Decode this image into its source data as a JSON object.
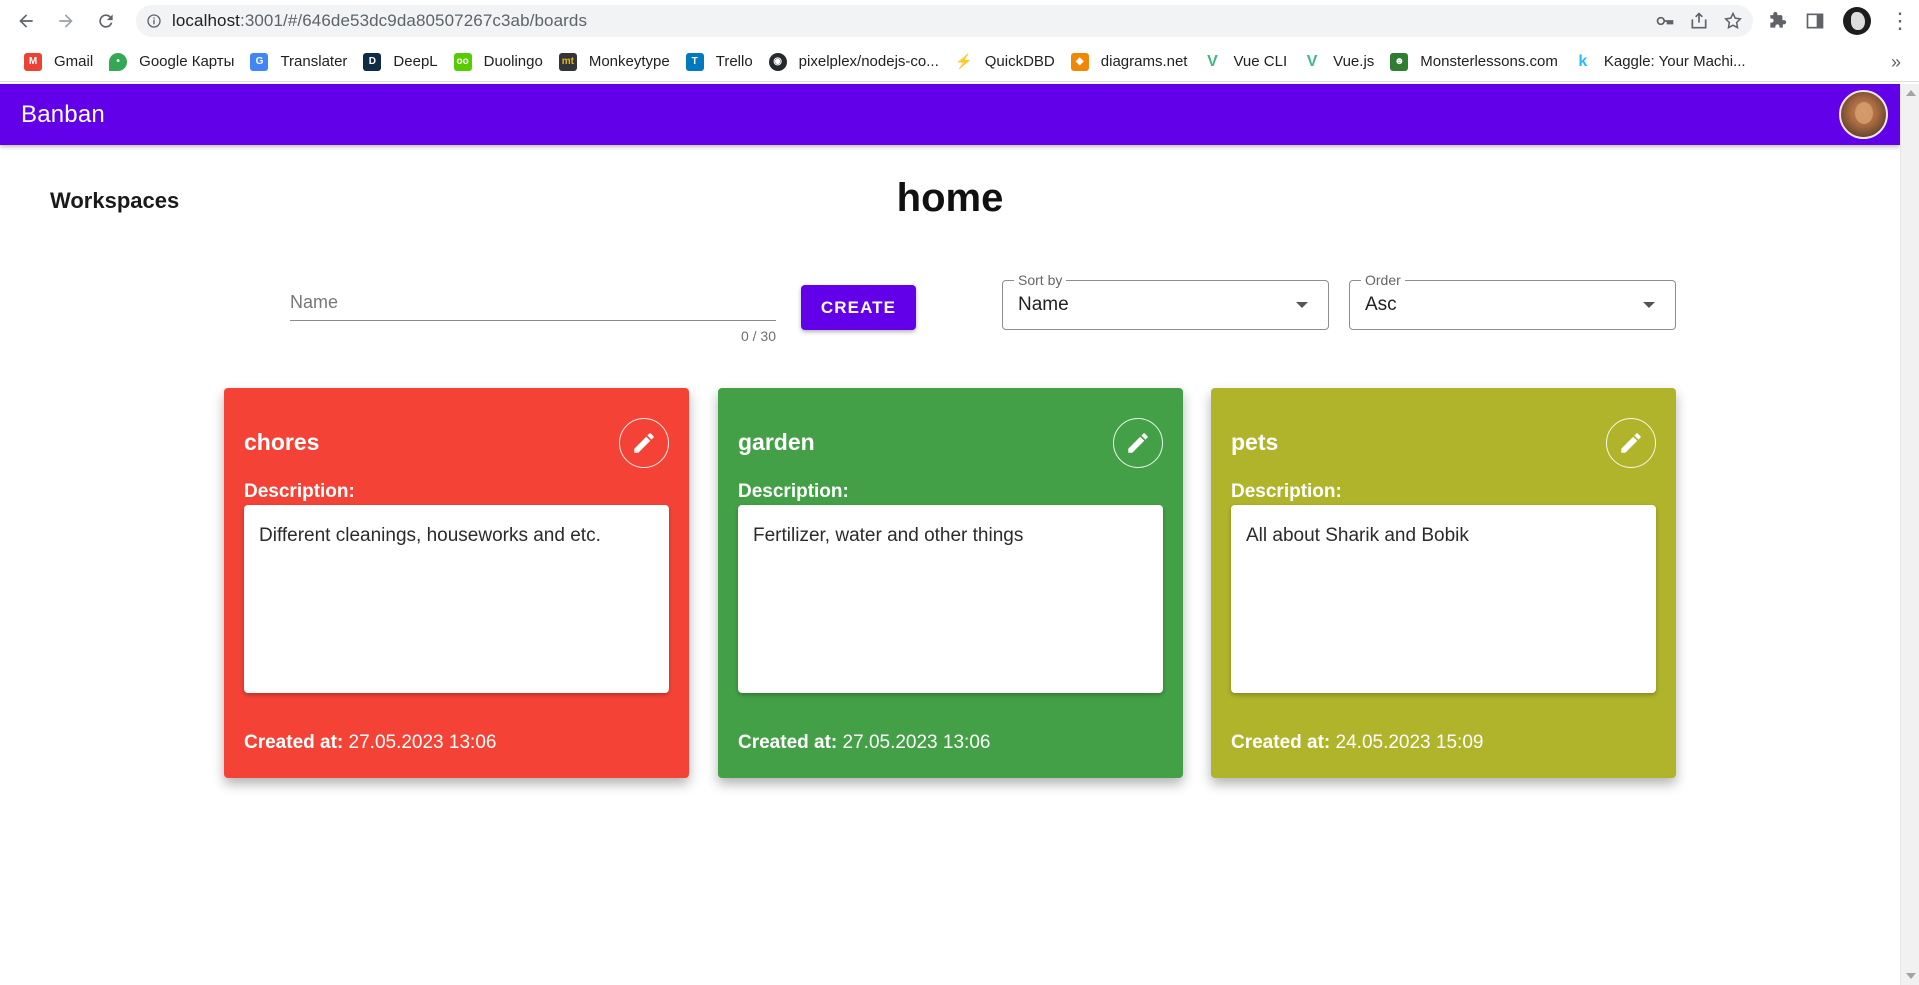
{
  "browser": {
    "url_host": "localhost",
    "url_rest": ":3001/#/646de53dc9da80507267c3ab/boards",
    "bookmarks": [
      {
        "label": "Gmail",
        "color": "#ea4335",
        "glyph": "M"
      },
      {
        "label": "Google Карты",
        "color": "#34a853",
        "glyph": "•"
      },
      {
        "label": "Translater",
        "color": "#4285f4",
        "glyph": "G"
      },
      {
        "label": "DeepL",
        "color": "#0f2b46",
        "glyph": "D"
      },
      {
        "label": "Duolingo",
        "color": "#58cc02",
        "glyph": "oo"
      },
      {
        "label": "Monkeytype",
        "color": "#323437",
        "glyph": "mt"
      },
      {
        "label": "Trello",
        "color": "#0079bf",
        "glyph": "T"
      },
      {
        "label": "pixelplex/nodejs-co...",
        "color": "#24292e",
        "glyph": "◉"
      },
      {
        "label": "QuickDBD",
        "color": "#4a90e2",
        "glyph": "⚡"
      },
      {
        "label": "diagrams.net",
        "color": "#f08705",
        "glyph": "◆"
      },
      {
        "label": "Vue CLI",
        "color": "#41b883",
        "glyph": "V"
      },
      {
        "label": "Vue.js",
        "color": "#41b883",
        "glyph": "V"
      },
      {
        "label": "Monsterlessons.com",
        "color": "#2e7d32",
        "glyph": "☻"
      },
      {
        "label": "Kaggle: Your Machi...",
        "color": "#20beff",
        "glyph": "k"
      }
    ],
    "more_glyph": "»"
  },
  "app": {
    "title": "Banban",
    "accent": "#6200ea"
  },
  "page": {
    "sidebar_title": "Workspaces",
    "title": "home"
  },
  "form": {
    "name_placeholder": "Name",
    "name_value": "",
    "counter": "0 / 30",
    "create_label": "CREATE",
    "sort": {
      "legend": "Sort by",
      "value": "Name"
    },
    "order": {
      "legend": "Order",
      "value": "Asc"
    }
  },
  "boards": [
    {
      "name": "chores",
      "description_label": "Description:",
      "description": "Different cleanings, houseworks and etc.",
      "created_label": "Created at:",
      "created_at": "27.05.2023 13:06",
      "color": "#f44336"
    },
    {
      "name": "garden",
      "description_label": "Description:",
      "description": "Fertilizer, water and other things",
      "created_label": "Created at:",
      "created_at": "27.05.2023 13:06",
      "color": "#43a047"
    },
    {
      "name": "pets",
      "description_label": "Description:",
      "description": "All about Sharik and Bobik",
      "created_label": "Created at:",
      "created_at": "24.05.2023 15:09",
      "color": "#afb42b"
    }
  ]
}
